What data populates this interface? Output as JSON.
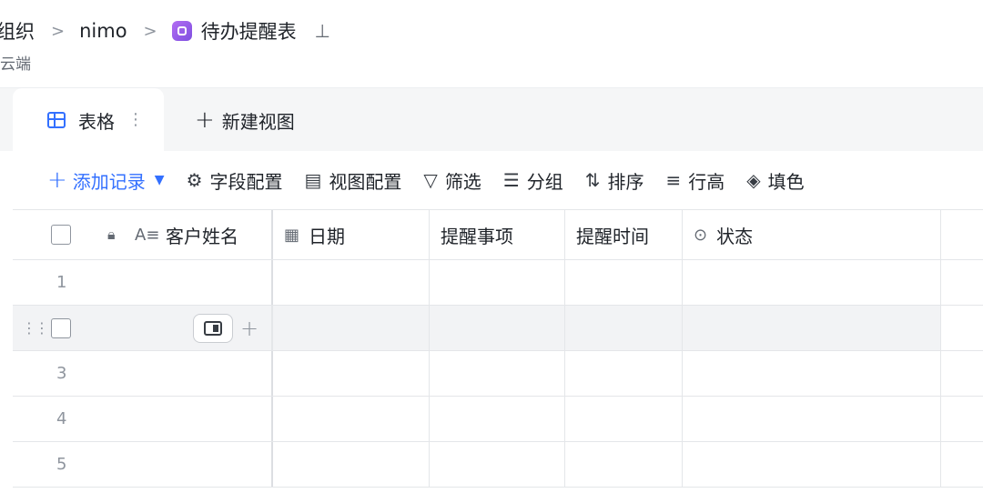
{
  "breadcrumb": {
    "org": "组织",
    "nimo": "nimo",
    "title": "待办提醒表",
    "sub": "云端"
  },
  "tabs": {
    "active_label": "表格",
    "new_view_label": "新建视图"
  },
  "toolbar": {
    "add_record": "添加记录",
    "field_config": "字段配置",
    "view_config": "视图配置",
    "filter": "筛选",
    "group": "分组",
    "sort": "排序",
    "row_height": "行高",
    "fill": "填色"
  },
  "table": {
    "columns": [
      "客户姓名",
      "日期",
      "提醒事项",
      "提醒时间",
      "状态"
    ],
    "rows": [
      "1",
      "",
      "3",
      "4",
      "5"
    ]
  },
  "colors": {
    "accent": "#3370ff",
    "app_icon": "#9b5cf0"
  }
}
